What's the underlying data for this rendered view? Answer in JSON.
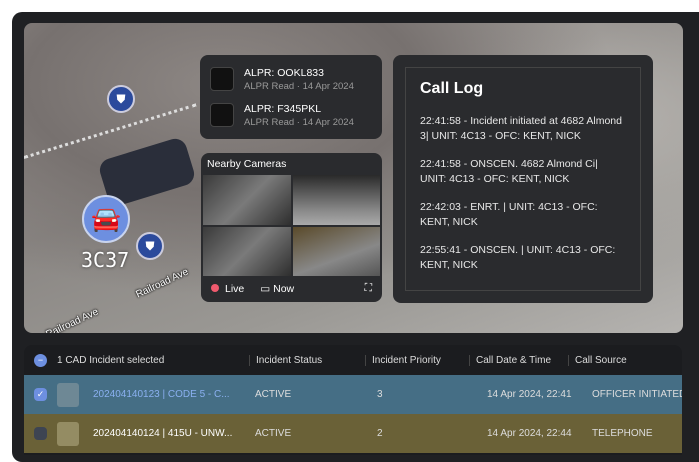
{
  "map": {
    "unit_label": "3C37",
    "streets": [
      "Railroad Ave",
      "Railroad Ave"
    ]
  },
  "alpr": [
    {
      "title": "ALPR: OOKL833",
      "sub": "ALPR Read · 14 Apr 2024"
    },
    {
      "title": "ALPR: F345PKL",
      "sub": "ALPR Read · 14 Apr 2024"
    }
  ],
  "cameras": {
    "title": "Nearby Cameras",
    "live": "Live",
    "now": "Now"
  },
  "call_log": {
    "title": "Call Log",
    "entries": [
      "22:41:58 - Incident initiated at 4682 Almond 3| UNIT: 4C13 - OFC: KENT, NICK",
      "22:41:58 - ONSCEN. 4682 Almond Ci| UNIT: 4C13 - OFC: KENT, NICK",
      "22:42:03 - ENRT.  | UNIT: 4C13 - OFC: KENT, NICK",
      "22:55:41 - ONSCEN.  | UNIT: 4C13 - OFC: KENT, NICK"
    ]
  },
  "table": {
    "headers": [
      "1 CAD Incident selected",
      "Incident Status",
      "Incident Priority",
      "Call Date & Time",
      "Call Source"
    ],
    "rows": [
      {
        "incident": "202404140123 | CODE 5 - C...",
        "status": "ACTIVE",
        "priority": "3",
        "datetime": "14 Apr 2024, 22:41",
        "source": "OFFICER INITIATED"
      },
      {
        "incident": "202404140124 | 415U - UNW...",
        "status": "ACTIVE",
        "priority": "2",
        "datetime": "14 Apr 2024, 22:44",
        "source": "TELEPHONE"
      }
    ]
  }
}
